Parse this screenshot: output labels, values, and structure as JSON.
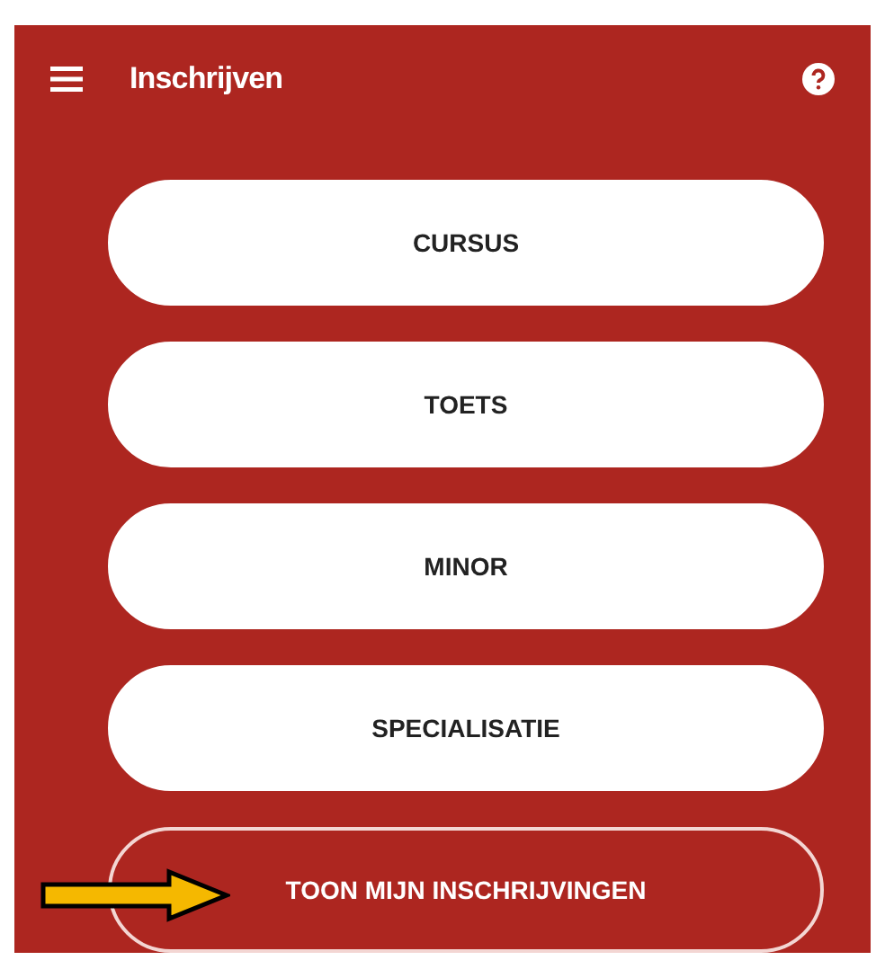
{
  "header": {
    "title": "Inschrijven"
  },
  "buttons": [
    {
      "label": "CURSUS",
      "kind": "filled"
    },
    {
      "label": "TOETS",
      "kind": "filled"
    },
    {
      "label": "MINOR",
      "kind": "filled"
    },
    {
      "label": "SPECIALISATIE",
      "kind": "filled"
    },
    {
      "label": "TOON MIJN INSCHRIJVINGEN",
      "kind": "outlined"
    }
  ]
}
